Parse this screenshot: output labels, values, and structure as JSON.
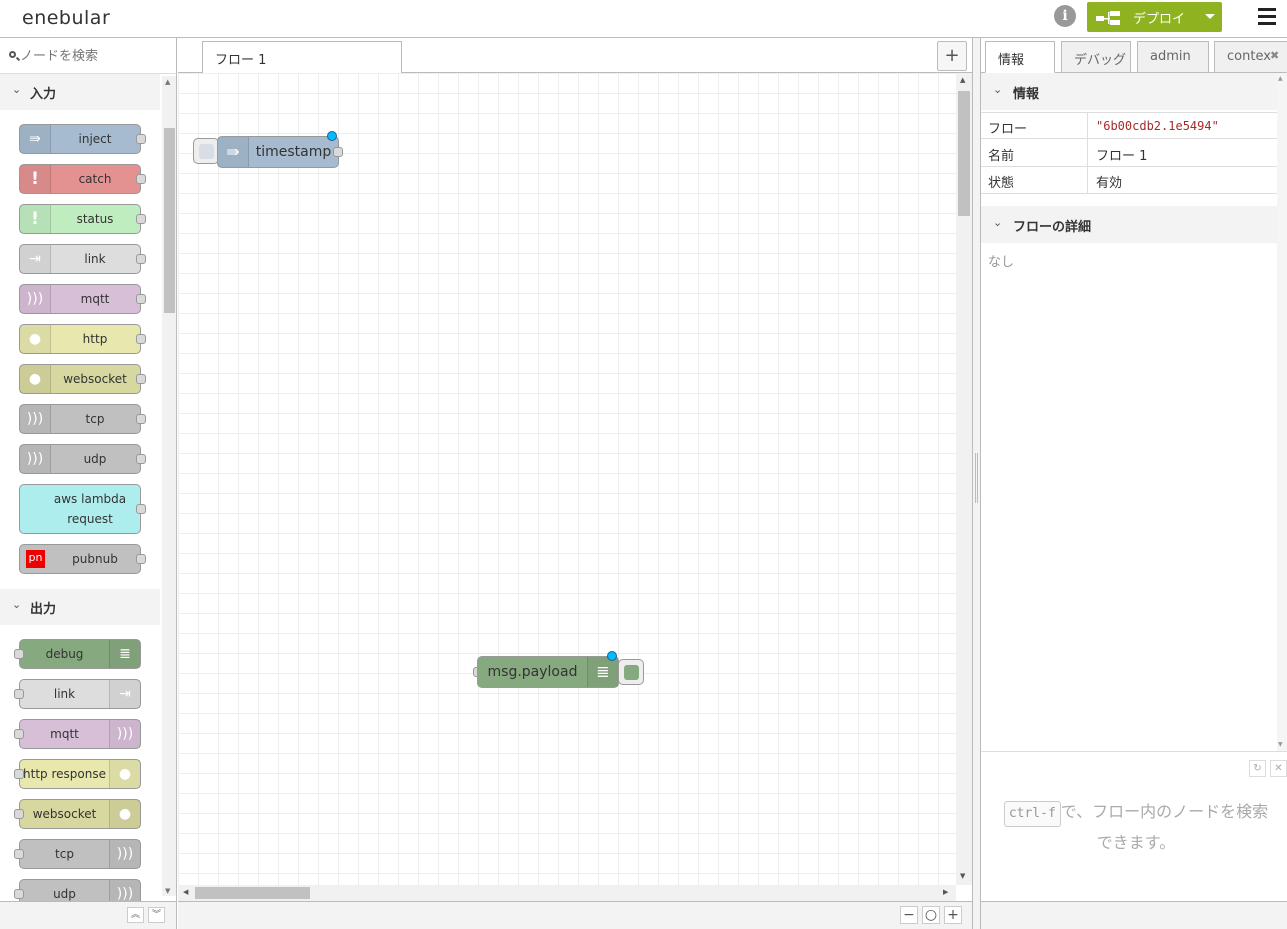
{
  "header": {
    "logo": "enebular",
    "deploy_label": "デプロイ"
  },
  "palette": {
    "search_placeholder": "ノードを検索",
    "categories": [
      {
        "label": "入力"
      },
      {
        "label": "出力"
      }
    ],
    "input_nodes": [
      {
        "label": "inject",
        "color": "#a6bbcf",
        "icon": "arrow-in-icon"
      },
      {
        "label": "catch",
        "color": "#e49191",
        "icon": "exclamation-icon"
      },
      {
        "label": "status",
        "color": "#c0edc0",
        "icon": "exclamation-icon"
      },
      {
        "label": "link",
        "color": "#dddddd",
        "icon": "link-in-icon"
      },
      {
        "label": "mqtt",
        "color": "#d8bfd8",
        "icon": "bridge-icon"
      },
      {
        "label": "http",
        "color": "#e7e7ae",
        "icon": "globe-icon"
      },
      {
        "label": "websocket",
        "color": "#d7d7a0",
        "icon": "globe-icon"
      },
      {
        "label": "tcp",
        "color": "#c0c0c0",
        "icon": "bridge-icon"
      },
      {
        "label": "udp",
        "color": "#c0c0c0",
        "icon": "bridge-icon"
      },
      {
        "label": "aws lambda",
        "label2": "request",
        "color": "#aeeded",
        "icon": ""
      },
      {
        "label": "pubnub",
        "color": "#c0c0c0",
        "icon": "pubnub-icon",
        "icon_text": "pn"
      }
    ],
    "output_nodes": [
      {
        "label": "debug",
        "color": "#87a980",
        "icon": "list-icon"
      },
      {
        "label": "link",
        "color": "#dddddd",
        "icon": "link-out-icon"
      },
      {
        "label": "mqtt",
        "color": "#d8bfd8",
        "icon": "bridge-icon"
      },
      {
        "label": "http response",
        "color": "#e7e7ae",
        "icon": "globe-icon"
      },
      {
        "label": "websocket",
        "color": "#d7d7a0",
        "icon": "globe-icon"
      },
      {
        "label": "tcp",
        "color": "#c0c0c0",
        "icon": "bridge-icon"
      },
      {
        "label": "udp",
        "color": "#c0c0c0",
        "icon": "bridge-icon"
      }
    ]
  },
  "workspace": {
    "tab_label": "フロー 1",
    "nodes": [
      {
        "label": "timestamp",
        "color": "#a6bbcf",
        "type": "inject"
      },
      {
        "label": "msg.payload",
        "color": "#87a980",
        "type": "debug"
      }
    ]
  },
  "sidebar": {
    "tabs": [
      "情報",
      "デバッグ",
      "admin",
      "contex"
    ],
    "info_section": "情報",
    "rows": [
      {
        "key": "フロー",
        "value": "\"6b00cdb2.1e5494\""
      },
      {
        "key": "名前",
        "value": "フロー 1"
      },
      {
        "key": "状態",
        "value": "有効"
      }
    ],
    "details_section": "フローの詳細",
    "details_text": "なし",
    "help": {
      "kbd": "ctrl-f",
      "text_after": "で、フロー内のノードを検索できます。"
    }
  }
}
